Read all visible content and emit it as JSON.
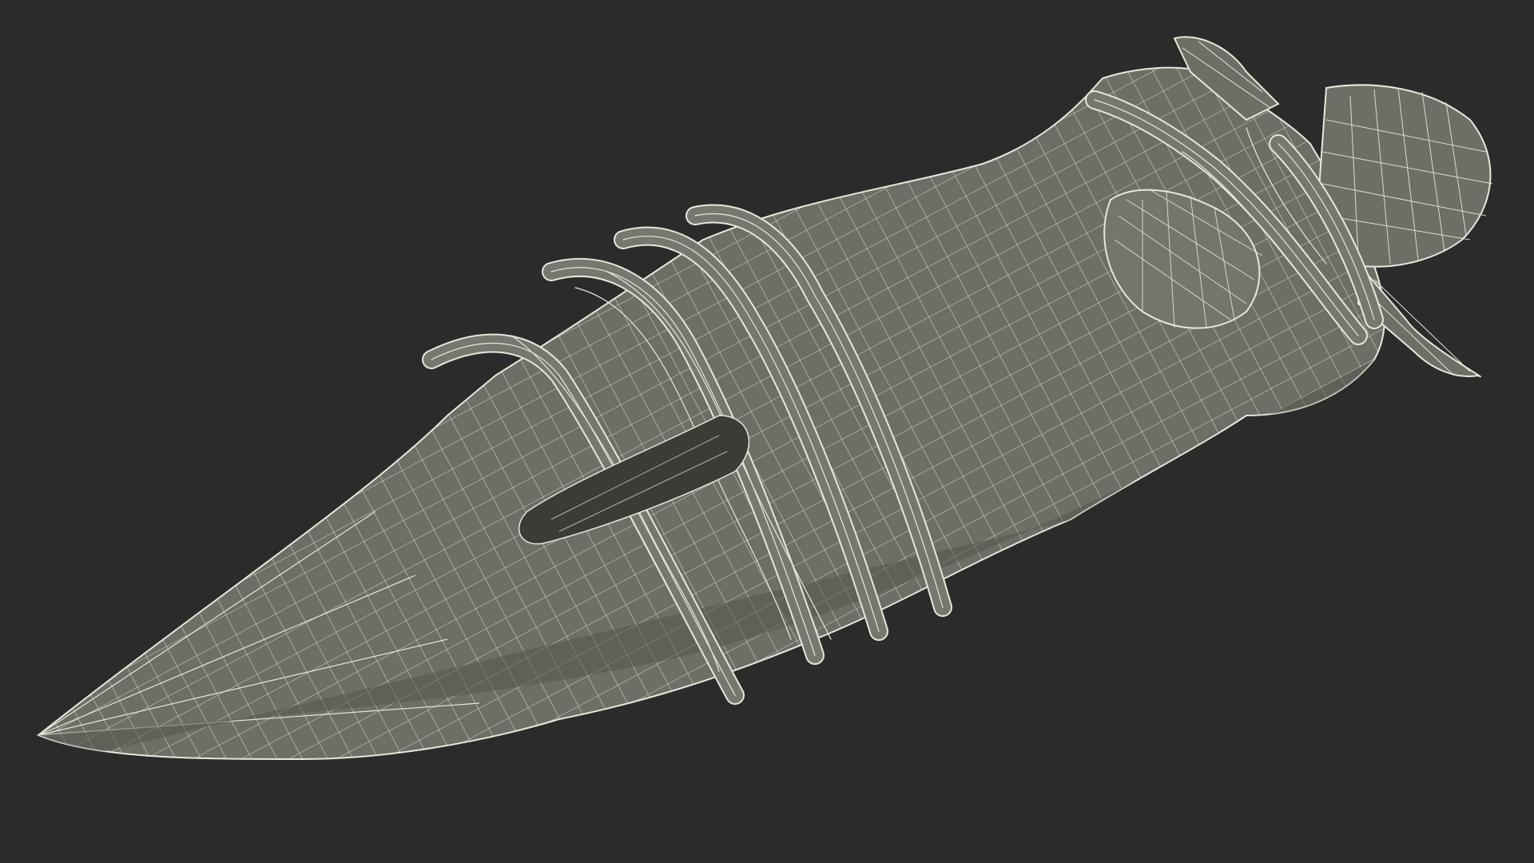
{
  "scene": {
    "background_color": "#2b2b2b",
    "mesh_fill_color": "#6e6e66",
    "mesh_shadow_color": "#55554e",
    "wireframe_color": "#e8e6dc",
    "rope_color": "#77776f",
    "object": "wireframe-sheathed-dagger-model"
  }
}
